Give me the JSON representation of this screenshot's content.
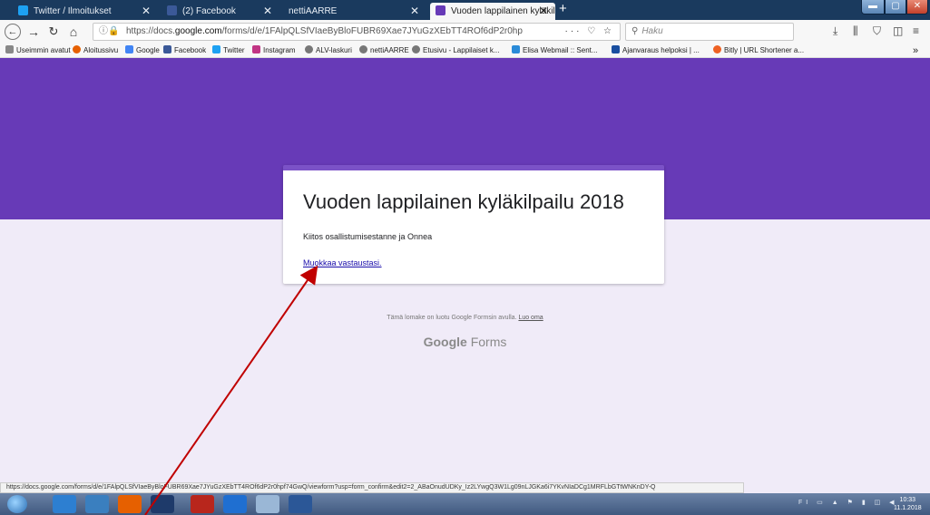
{
  "tabs": [
    {
      "label": "Twitter / Ilmoitukset",
      "color": "#1da1f2"
    },
    {
      "label": "(2) Facebook",
      "color": "#3b5998"
    },
    {
      "label": "nettiAARRE",
      "color": "#1a3a5e"
    },
    {
      "label": "Vuoden lappilainen kyläkilpailu",
      "color": "#673ab7"
    }
  ],
  "address": {
    "prefix": "https://docs.",
    "domain": "google.com",
    "path": "/forms/d/e/1FAlpQLSfVIaeByBloFUBR69Xae7JYuGzXEbTT4ROf6dP2r0hp"
  },
  "search": {
    "placeholder": "Haku"
  },
  "bookmarks": [
    "Useimmin avatut",
    "Aloitussivu",
    "Google",
    "Facebook",
    "Twitter",
    "Instagram",
    "ALV-laskuri",
    "nettiAARRE",
    "Etusivu - Lappilaiset k...",
    "Elisa Webmail :: Sent...",
    "Ajanvaraus helpoksi | ...",
    "Bitly | URL Shortener a..."
  ],
  "form": {
    "title": "Vuoden lappilainen kyläkilpailu 2018",
    "message": "Kiitos osallistumisestanne ja Onnea",
    "edit_link": "Muokkaa vastaustasi.",
    "footer_text": "Tämä lomake on luotu Google Formsin avulla.",
    "footer_link": "Luo oma",
    "brand_google": "Google",
    "brand_forms": "Forms"
  },
  "status_url": "https://docs.google.com/forms/d/e/1FAlpQLSfVIaeByBloFUBR69Xae7JYuGzXEbTT4ROf6dP2r0hpf74GwQ/viewform?usp=form_confirm&edit2=2_ABaOnudUDKy_Iz2LYwgQ3W1Lg09nLJGKa6i7YKvNIaDCg1MRFLbGTtWNKnDY-Q",
  "clock": {
    "time": "10:33",
    "date": "11.1.2018"
  },
  "colors": {
    "banner": "#673ab7",
    "page_bg": "#f0ebf8",
    "arrow": "#c00000"
  }
}
